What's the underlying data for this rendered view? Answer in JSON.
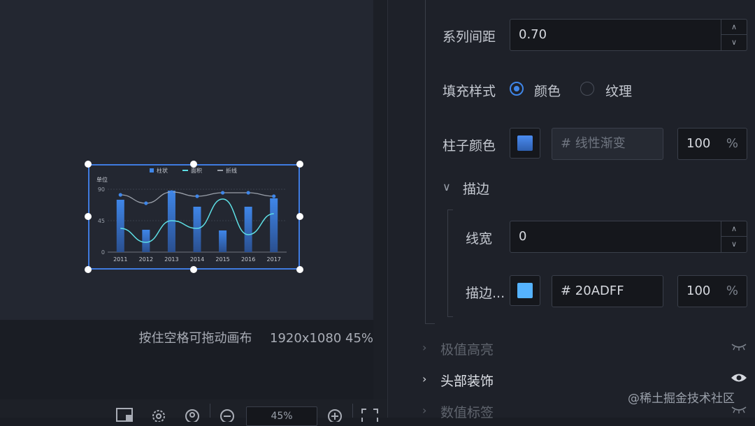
{
  "canvas": {
    "hint": "按住空格可拖动画布",
    "resolution": "1920x1080 45%",
    "zoom_value": "45%"
  },
  "chart_data": {
    "type": "bar",
    "legend": [
      "柱状",
      "面积",
      "折线"
    ],
    "legend_position": "top-center",
    "ylabel": "单位",
    "ylim": [
      0,
      90
    ],
    "yticks": [
      "90",
      "45",
      "0"
    ],
    "categories": [
      "2011",
      "2012",
      "2013",
      "2014",
      "2015",
      "2016",
      "2017"
    ],
    "series": [
      {
        "name": "柱状",
        "kind": "bar",
        "values": [
          75,
          32,
          88,
          65,
          31,
          65,
          77
        ]
      },
      {
        "name": "面积",
        "kind": "smooth-line",
        "values": [
          34,
          14,
          45,
          34,
          76,
          25,
          55
        ]
      },
      {
        "name": "折线",
        "kind": "line",
        "values": [
          82,
          70,
          86,
          80,
          85,
          85,
          80
        ]
      }
    ],
    "colors": {
      "bar": "#3f86e8",
      "area": "#5ee0e6",
      "line": "#9aa0aa"
    }
  },
  "panel": {
    "series_gap": {
      "label": "系列间距",
      "value": "0.70"
    },
    "fill_style": {
      "label": "填充样式",
      "options": [
        "颜色",
        "纹理"
      ],
      "selected": "颜色"
    },
    "bar_color": {
      "label": "柱子颜色",
      "color": "#3f86e8",
      "placeholder": "# 线性渐变",
      "opacity": "100",
      "unit": "%"
    },
    "stroke_section": {
      "label": "描边"
    },
    "line_width": {
      "label": "线宽",
      "value": "0"
    },
    "stroke_color": {
      "label": "描边...",
      "color": "#55b3ff",
      "hex": "# 20ADFF",
      "opacity": "100",
      "unit": "%"
    },
    "sections": [
      {
        "label": "极值高亮",
        "visible": false
      },
      {
        "label": "头部装饰",
        "visible": true
      },
      {
        "label": "数值标签",
        "visible": false
      }
    ],
    "watermark": "@稀土掘金技术社区"
  }
}
